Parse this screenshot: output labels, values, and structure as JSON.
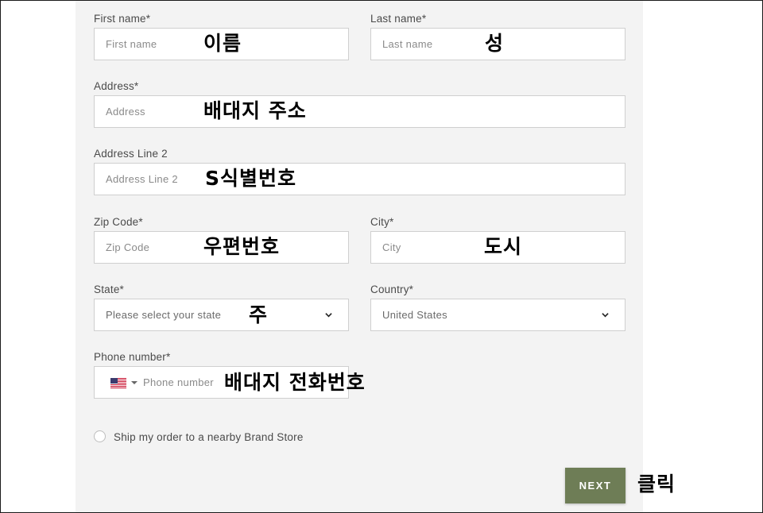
{
  "form": {
    "first_name": {
      "label": "First name*",
      "placeholder": "First name",
      "note": "이름"
    },
    "last_name": {
      "label": "Last name*",
      "placeholder": "Last name",
      "note": "성"
    },
    "address": {
      "label": "Address*",
      "placeholder": "Address",
      "note": "배대지 주소"
    },
    "address_line2": {
      "label": "Address Line 2",
      "placeholder": "Address Line 2",
      "note": "S식별번호"
    },
    "zip_code": {
      "label": "Zip Code*",
      "placeholder": "Zip Code",
      "note": "우편번호"
    },
    "city": {
      "label": "City*",
      "placeholder": "City",
      "note": "도시"
    },
    "state": {
      "label": "State*",
      "value": "Please select your state",
      "note": "주"
    },
    "country": {
      "label": "Country*",
      "value": "United States"
    },
    "phone": {
      "label": "Phone number*",
      "placeholder": "Phone number",
      "note": "배대지 전화번호",
      "flag_icon": "us-flag-icon"
    },
    "ship_to_store": {
      "label": "Ship my order to a nearby Brand Store"
    },
    "next": {
      "label": "NEXT",
      "note": "클릭"
    }
  },
  "colors": {
    "panel_bg": "#f3f3f3",
    "input_border": "#cfcfcf",
    "button_bg": "#6e7d56",
    "button_text": "#ffffff"
  }
}
